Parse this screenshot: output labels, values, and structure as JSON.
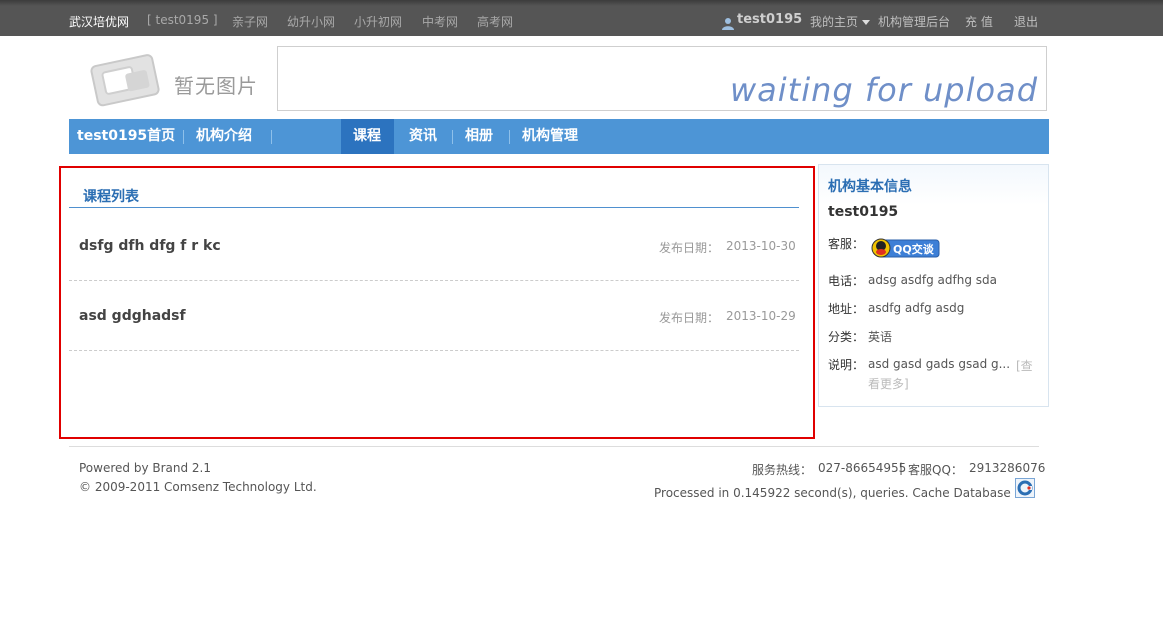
{
  "topbar": {
    "site": "武汉培优网",
    "user_tag": "[ test0195 ]",
    "links": [
      "亲子网",
      "幼升小网",
      "小升初网",
      "中考网",
      "高考网"
    ],
    "username": "test0195",
    "my_home": "我的主页",
    "admin": "机构管理后台",
    "recharge": "充 值",
    "logout": "退出"
  },
  "logo": {
    "text": "暂无图片"
  },
  "banner": {
    "text": "waiting for upload"
  },
  "nav": {
    "items": [
      "test0195首页",
      "机构介绍",
      "课程",
      "资讯",
      "相册",
      "机构管理"
    ],
    "active_index": 2
  },
  "course_panel": {
    "title": "课程列表",
    "date_label": "发布日期：",
    "items": [
      {
        "name": "dsfg dfh dfg f r kc",
        "date": "2013-10-30"
      },
      {
        "name": "asd gdghadsf",
        "date": "2013-10-29"
      }
    ]
  },
  "side": {
    "title": "机构基本信息",
    "name": "test0195",
    "service_label": "客服：",
    "qq_button": "QQ交谈",
    "phone_label": "电话：",
    "phone": "adsg asdfg adfhg sda",
    "address_label": "地址：",
    "address": "asdfg adfg asdg",
    "category_label": "分类：",
    "category": "英语",
    "desc_label": "说明：",
    "desc": "asd gasd gads gsad g...",
    "more_1": "[查",
    "more_2": "看更多]"
  },
  "footer": {
    "powered": "Powered by Brand 2.1",
    "copyright": "© 2009-2011 Comsenz Technology Ltd.",
    "hotline_label": "服务热线：",
    "hotline": "027-86654955",
    "qq_label": "客服QQ：",
    "qq": "2913286076",
    "processed": "Processed in 0.145922 second(s), queries. Cache Database On."
  },
  "colors": {
    "topbar": "#555555",
    "nav": "#4d95d6",
    "nav_active": "#2c73bf",
    "title_blue": "#2b6eb3",
    "highlight_box": "#e00000"
  }
}
